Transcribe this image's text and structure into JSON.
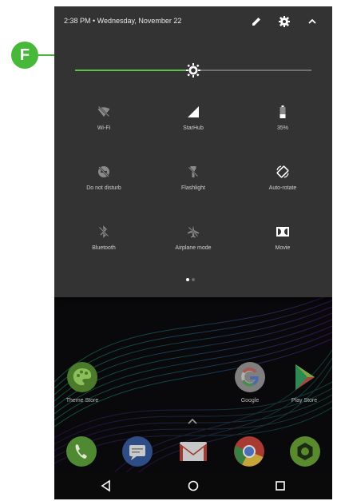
{
  "annotation": {
    "marker_label": "F",
    "color": "#48b83a"
  },
  "status_bar": {
    "text": "2:38 PM • Wednesday, November 22"
  },
  "header_icons": [
    "edit-icon",
    "gear-icon",
    "chevron-up-icon"
  ],
  "brightness": {
    "level_percent": 50,
    "accent_color": "#5cc249"
  },
  "tiles": [
    {
      "label": "Wi-Fi",
      "icon": "wifi-off-icon",
      "active": false
    },
    {
      "label": "StarHub",
      "icon": "cellular-signal-icon",
      "active": true
    },
    {
      "label": "35%",
      "icon": "battery-icon",
      "active": true
    },
    {
      "label": "Do not disturb",
      "icon": "do-not-disturb-off-icon",
      "active": false
    },
    {
      "label": "Flashlight",
      "icon": "flashlight-off-icon",
      "active": false
    },
    {
      "label": "Auto-rotate",
      "icon": "auto-rotate-icon",
      "active": true
    },
    {
      "label": "Bluetooth",
      "icon": "bluetooth-off-icon",
      "active": false
    },
    {
      "label": "Airplane mode",
      "icon": "airplane-off-icon",
      "active": false
    },
    {
      "label": "Movie",
      "icon": "dolby-icon",
      "active": true
    }
  ],
  "qs_pages": {
    "current": 1,
    "total": 2
  },
  "home_apps": [
    {
      "label": "Theme Store",
      "icon": "palette-icon"
    },
    {
      "label": "Google",
      "icon": "google-icon"
    },
    {
      "label": "Play Store",
      "icon": "play-store-icon"
    }
  ],
  "dock": [
    "phone-icon",
    "messages-icon",
    "gmail-icon",
    "chrome-icon",
    "camera-icon"
  ],
  "nav_buttons": [
    "back-icon",
    "home-icon",
    "recents-icon"
  ]
}
